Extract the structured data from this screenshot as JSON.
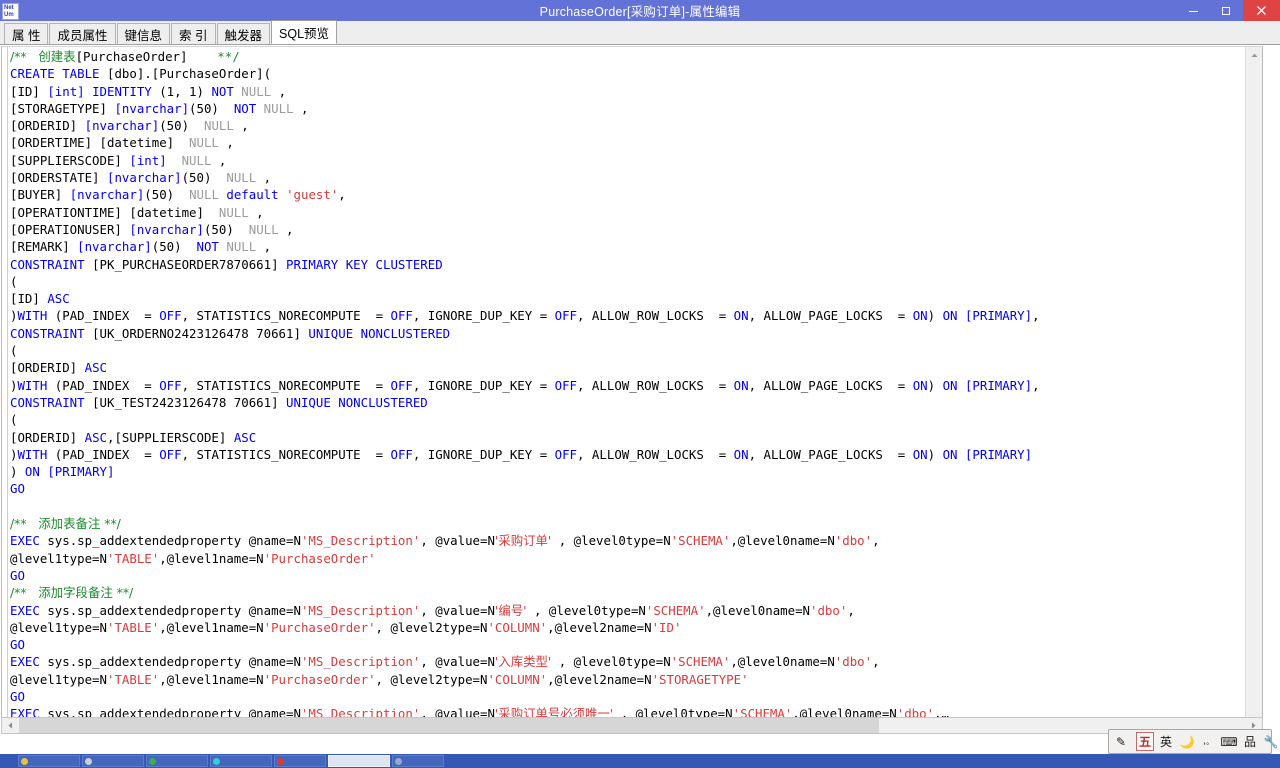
{
  "window": {
    "title": "PurchaseOrder[采购订单]-属性编辑",
    "logo_line1": "Net",
    "logo_line2": "Um",
    "controls": {
      "minimize": "minimize-button",
      "maximize": "restore-button",
      "close": "close-button"
    },
    "accent_titlebar": "#6272d6",
    "accent_close": "#e04344"
  },
  "tabs": [
    {
      "label": "属 性",
      "active": false
    },
    {
      "label": "成员属性",
      "active": false
    },
    {
      "label": "键信息",
      "active": false
    },
    {
      "label": "索 引",
      "active": false
    },
    {
      "label": "触发器",
      "active": false
    },
    {
      "label": "SQL预览",
      "active": true
    }
  ],
  "colors": {
    "keyword": "#0000ee",
    "comment": "#1c8b2c",
    "string": "#d83b3b",
    "null": "#9c9c9c",
    "text": "#000000"
  },
  "editor": {
    "lines": [
      [
        {
          "t": "/**   创建表",
          "c": "cm"
        },
        {
          "t": "[PurchaseOrder]",
          "c": ""
        },
        {
          "t": "    **/",
          "c": "cm"
        }
      ],
      [
        {
          "t": "CREATE TABLE ",
          "c": "kw"
        },
        {
          "t": "[dbo].[PurchaseOrder](",
          "c": ""
        }
      ],
      [
        {
          "t": "[ID] ",
          "c": ""
        },
        {
          "t": "[int] ",
          "c": "kw"
        },
        {
          "t": "IDENTITY ",
          "c": "kw"
        },
        {
          "t": "(1, 1) ",
          "c": ""
        },
        {
          "t": "NOT ",
          "c": "kw"
        },
        {
          "t": "NULL",
          "c": "nul"
        },
        {
          "t": " ,",
          "c": ""
        }
      ],
      [
        {
          "t": "[STORAGETYPE] ",
          "c": ""
        },
        {
          "t": "[nvarchar]",
          "c": "kw"
        },
        {
          "t": "(50)  ",
          "c": ""
        },
        {
          "t": "NOT ",
          "c": "kw"
        },
        {
          "t": "NULL",
          "c": "nul"
        },
        {
          "t": " ,",
          "c": ""
        }
      ],
      [
        {
          "t": "[ORDERID] ",
          "c": ""
        },
        {
          "t": "[nvarchar]",
          "c": "kw"
        },
        {
          "t": "(50)  ",
          "c": ""
        },
        {
          "t": "NULL",
          "c": "nul"
        },
        {
          "t": " ,",
          "c": ""
        }
      ],
      [
        {
          "t": "[ORDERTIME] [datetime]  ",
          "c": ""
        },
        {
          "t": "NULL",
          "c": "nul"
        },
        {
          "t": " ,",
          "c": ""
        }
      ],
      [
        {
          "t": "[SUPPLIERSCODE] ",
          "c": ""
        },
        {
          "t": "[int]",
          "c": "kw"
        },
        {
          "t": "  ",
          "c": ""
        },
        {
          "t": "NULL",
          "c": "nul"
        },
        {
          "t": " ,",
          "c": ""
        }
      ],
      [
        {
          "t": "[ORDERSTATE] ",
          "c": ""
        },
        {
          "t": "[nvarchar]",
          "c": "kw"
        },
        {
          "t": "(50)  ",
          "c": ""
        },
        {
          "t": "NULL",
          "c": "nul"
        },
        {
          "t": " ,",
          "c": ""
        }
      ],
      [
        {
          "t": "[BUYER] ",
          "c": ""
        },
        {
          "t": "[nvarchar]",
          "c": "kw"
        },
        {
          "t": "(50)  ",
          "c": ""
        },
        {
          "t": "NULL ",
          "c": "nul"
        },
        {
          "t": "default ",
          "c": "kw"
        },
        {
          "t": "'guest'",
          "c": "str"
        },
        {
          "t": ",",
          "c": ""
        }
      ],
      [
        {
          "t": "[OPERATIONTIME] [datetime]  ",
          "c": ""
        },
        {
          "t": "NULL",
          "c": "nul"
        },
        {
          "t": " ,",
          "c": ""
        }
      ],
      [
        {
          "t": "[OPERATIONUSER] ",
          "c": ""
        },
        {
          "t": "[nvarchar]",
          "c": "kw"
        },
        {
          "t": "(50)  ",
          "c": ""
        },
        {
          "t": "NULL",
          "c": "nul"
        },
        {
          "t": " ,",
          "c": ""
        }
      ],
      [
        {
          "t": "[REMARK] ",
          "c": ""
        },
        {
          "t": "[nvarchar]",
          "c": "kw"
        },
        {
          "t": "(50)  ",
          "c": ""
        },
        {
          "t": "NOT ",
          "c": "kw"
        },
        {
          "t": "NULL",
          "c": "nul"
        },
        {
          "t": " ,",
          "c": ""
        }
      ],
      [
        {
          "t": "CONSTRAINT ",
          "c": "kw"
        },
        {
          "t": "[PK_PURCHASEORDER7870661] ",
          "c": ""
        },
        {
          "t": "PRIMARY KEY CLUSTERED",
          "c": "kw"
        }
      ],
      [
        {
          "t": "(",
          "c": ""
        }
      ],
      [
        {
          "t": "[ID] ",
          "c": ""
        },
        {
          "t": "ASC",
          "c": "kw"
        }
      ],
      [
        {
          "t": ")",
          "c": ""
        },
        {
          "t": "WITH ",
          "c": "kw"
        },
        {
          "t": "(PAD_INDEX  = ",
          "c": ""
        },
        {
          "t": "OFF",
          "c": "kw"
        },
        {
          "t": ", STATISTICS_NORECOMPUTE  = ",
          "c": ""
        },
        {
          "t": "OFF",
          "c": "kw"
        },
        {
          "t": ", IGNORE_DUP_KEY = ",
          "c": ""
        },
        {
          "t": "OFF",
          "c": "kw"
        },
        {
          "t": ", ALLOW_ROW_LOCKS  = ",
          "c": ""
        },
        {
          "t": "ON",
          "c": "kw"
        },
        {
          "t": ", ALLOW_PAGE_LOCKS  = ",
          "c": ""
        },
        {
          "t": "ON",
          "c": "kw"
        },
        {
          "t": ") ",
          "c": ""
        },
        {
          "t": "ON ",
          "c": "kw"
        },
        {
          "t": "[PRIMARY]",
          "c": "kw"
        },
        {
          "t": ",",
          "c": ""
        }
      ],
      [
        {
          "t": "CONSTRAINT ",
          "c": "kw"
        },
        {
          "t": "[UK_ORDERNO2423126478 70661] ",
          "c": ""
        },
        {
          "t": "UNIQUE NONCLUSTERED",
          "c": "kw"
        }
      ],
      [
        {
          "t": "(",
          "c": ""
        }
      ],
      [
        {
          "t": "[ORDERID] ",
          "c": ""
        },
        {
          "t": "ASC",
          "c": "kw"
        }
      ],
      [
        {
          "t": ")",
          "c": ""
        },
        {
          "t": "WITH ",
          "c": "kw"
        },
        {
          "t": "(PAD_INDEX  = ",
          "c": ""
        },
        {
          "t": "OFF",
          "c": "kw"
        },
        {
          "t": ", STATISTICS_NORECOMPUTE  = ",
          "c": ""
        },
        {
          "t": "OFF",
          "c": "kw"
        },
        {
          "t": ", IGNORE_DUP_KEY = ",
          "c": ""
        },
        {
          "t": "OFF",
          "c": "kw"
        },
        {
          "t": ", ALLOW_ROW_LOCKS  = ",
          "c": ""
        },
        {
          "t": "ON",
          "c": "kw"
        },
        {
          "t": ", ALLOW_PAGE_LOCKS  = ",
          "c": ""
        },
        {
          "t": "ON",
          "c": "kw"
        },
        {
          "t": ") ",
          "c": ""
        },
        {
          "t": "ON ",
          "c": "kw"
        },
        {
          "t": "[PRIMARY]",
          "c": "kw"
        },
        {
          "t": ",",
          "c": ""
        }
      ],
      [
        {
          "t": "CONSTRAINT ",
          "c": "kw"
        },
        {
          "t": "[UK_TEST2423126478 70661] ",
          "c": ""
        },
        {
          "t": "UNIQUE NONCLUSTERED",
          "c": "kw"
        }
      ],
      [
        {
          "t": "(",
          "c": ""
        }
      ],
      [
        {
          "t": "[ORDERID] ",
          "c": ""
        },
        {
          "t": "ASC",
          "c": "kw"
        },
        {
          "t": ",[SUPPLIERSCODE] ",
          "c": ""
        },
        {
          "t": "ASC",
          "c": "kw"
        }
      ],
      [
        {
          "t": ")",
          "c": ""
        },
        {
          "t": "WITH ",
          "c": "kw"
        },
        {
          "t": "(PAD_INDEX  = ",
          "c": ""
        },
        {
          "t": "OFF",
          "c": "kw"
        },
        {
          "t": ", STATISTICS_NORECOMPUTE  = ",
          "c": ""
        },
        {
          "t": "OFF",
          "c": "kw"
        },
        {
          "t": ", IGNORE_DUP_KEY = ",
          "c": ""
        },
        {
          "t": "OFF",
          "c": "kw"
        },
        {
          "t": ", ALLOW_ROW_LOCKS  = ",
          "c": ""
        },
        {
          "t": "ON",
          "c": "kw"
        },
        {
          "t": ", ALLOW_PAGE_LOCKS  = ",
          "c": ""
        },
        {
          "t": "ON",
          "c": "kw"
        },
        {
          "t": ") ",
          "c": ""
        },
        {
          "t": "ON ",
          "c": "kw"
        },
        {
          "t": "[PRIMARY]",
          "c": "kw"
        }
      ],
      [
        {
          "t": ") ",
          "c": ""
        },
        {
          "t": "ON ",
          "c": "kw"
        },
        {
          "t": "[PRIMARY]",
          "c": "kw"
        }
      ],
      [
        {
          "t": "GO",
          "c": "kw"
        }
      ],
      [
        {
          "t": "",
          "c": ""
        }
      ],
      [
        {
          "t": "/**   添加表备注 **/",
          "c": "cm"
        }
      ],
      [
        {
          "t": "EXEC ",
          "c": "kw"
        },
        {
          "t": "sys.sp_addextendedproperty @name=N",
          "c": ""
        },
        {
          "t": "'MS_Description'",
          "c": "str"
        },
        {
          "t": ", @value=N",
          "c": ""
        },
        {
          "t": "'采购订单'",
          "c": "str"
        },
        {
          "t": " , @level0type=N",
          "c": ""
        },
        {
          "t": "'SCHEMA'",
          "c": "str"
        },
        {
          "t": ",@level0name=N",
          "c": ""
        },
        {
          "t": "'dbo'",
          "c": "str"
        },
        {
          "t": ",",
          "c": ""
        }
      ],
      [
        {
          "t": "@level1type=N",
          "c": ""
        },
        {
          "t": "'TABLE'",
          "c": "str"
        },
        {
          "t": ",@level1name=N",
          "c": ""
        },
        {
          "t": "'PurchaseOrder'",
          "c": "str"
        }
      ],
      [
        {
          "t": "GO",
          "c": "kw"
        }
      ],
      [
        {
          "t": "/**   添加字段备注 **/",
          "c": "cm"
        }
      ],
      [
        {
          "t": "EXEC ",
          "c": "kw"
        },
        {
          "t": "sys.sp_addextendedproperty @name=N",
          "c": ""
        },
        {
          "t": "'MS_Description'",
          "c": "str"
        },
        {
          "t": ", @value=N",
          "c": ""
        },
        {
          "t": "'编号'",
          "c": "str"
        },
        {
          "t": " , @level0type=N",
          "c": ""
        },
        {
          "t": "'SCHEMA'",
          "c": "str"
        },
        {
          "t": ",@level0name=N",
          "c": ""
        },
        {
          "t": "'dbo'",
          "c": "str"
        },
        {
          "t": ",",
          "c": ""
        }
      ],
      [
        {
          "t": "@level1type=N",
          "c": ""
        },
        {
          "t": "'TABLE'",
          "c": "str"
        },
        {
          "t": ",@level1name=N",
          "c": ""
        },
        {
          "t": "'PurchaseOrder'",
          "c": "str"
        },
        {
          "t": ", @level2type=N",
          "c": ""
        },
        {
          "t": "'COLUMN'",
          "c": "str"
        },
        {
          "t": ",@level2name=N",
          "c": ""
        },
        {
          "t": "'ID'",
          "c": "str"
        }
      ],
      [
        {
          "t": "GO",
          "c": "kw"
        }
      ],
      [
        {
          "t": "EXEC ",
          "c": "kw"
        },
        {
          "t": "sys.sp_addextendedproperty @name=N",
          "c": ""
        },
        {
          "t": "'MS_Description'",
          "c": "str"
        },
        {
          "t": ", @value=N",
          "c": ""
        },
        {
          "t": "'入库类型'",
          "c": "str"
        },
        {
          "t": " , @level0type=N",
          "c": ""
        },
        {
          "t": "'SCHEMA'",
          "c": "str"
        },
        {
          "t": ",@level0name=N",
          "c": ""
        },
        {
          "t": "'dbo'",
          "c": "str"
        },
        {
          "t": ",",
          "c": ""
        }
      ],
      [
        {
          "t": "@level1type=N",
          "c": ""
        },
        {
          "t": "'TABLE'",
          "c": "str"
        },
        {
          "t": ",@level1name=N",
          "c": ""
        },
        {
          "t": "'PurchaseOrder'",
          "c": "str"
        },
        {
          "t": ", @level2type=N",
          "c": ""
        },
        {
          "t": "'COLUMN'",
          "c": "str"
        },
        {
          "t": ",@level2name=N",
          "c": ""
        },
        {
          "t": "'STORAGETYPE'",
          "c": "str"
        }
      ],
      [
        {
          "t": "GO",
          "c": "kw"
        }
      ],
      [
        {
          "t": "EXEC ",
          "c": "kw"
        },
        {
          "t": "sys.sp_addextendedproperty @name=N",
          "c": ""
        },
        {
          "t": "'MS_Description'",
          "c": "str"
        },
        {
          "t": ", @value=N",
          "c": ""
        },
        {
          "t": "'采购订单号必须唯一'",
          "c": "str"
        },
        {
          "t": " , @level0type=N",
          "c": ""
        },
        {
          "t": "'SCHEMA'",
          "c": "str"
        },
        {
          "t": ",@level0name=N",
          "c": ""
        },
        {
          "t": "'dbo'",
          "c": "str"
        },
        {
          "t": ",…",
          "c": ""
        }
      ]
    ]
  },
  "scrollbars": {
    "vertical_up": "scroll-up-arrow",
    "vertical_down": "scroll-down-arrow",
    "horizontal_left": "scroll-left-arrow",
    "horizontal_right": "scroll-right-arrow"
  },
  "ime": {
    "items": [
      {
        "name": "ime-status-icon",
        "glyph": "✎",
        "boxed": false
      },
      {
        "name": "ime-mode-chinese",
        "glyph": "五",
        "boxed": true
      },
      {
        "name": "ime-mode-english",
        "glyph": "英",
        "boxed": false
      },
      {
        "name": "ime-halfwidth-icon",
        "glyph": "🌙",
        "boxed": false
      },
      {
        "name": "ime-punctuation-icon",
        "glyph": "，。",
        "boxed": false
      },
      {
        "name": "ime-soft-keyboard-icon",
        "glyph": "⌨",
        "boxed": false
      },
      {
        "name": "ime-toolbox-icon",
        "glyph": "品",
        "boxed": false
      },
      {
        "name": "ime-settings-icon",
        "glyph": "🔧",
        "boxed": false
      }
    ]
  },
  "taskbar": {
    "items": [
      {
        "name": "taskbar-item-1",
        "color": "#e8c13a",
        "style": "wide"
      },
      {
        "name": "taskbar-item-2",
        "color": "#c9cdd6",
        "style": "wide"
      },
      {
        "name": "taskbar-item-3",
        "color": "#3fae4a",
        "style": "wide"
      },
      {
        "name": "taskbar-item-4",
        "color": "#2fd0d7",
        "style": "wide"
      },
      {
        "name": "taskbar-item-5",
        "color": "#e03a2f",
        "style": "mid"
      },
      {
        "name": "taskbar-item-6",
        "color": "#dfe4f3",
        "style": "light"
      },
      {
        "name": "taskbar-item-7",
        "color": "#98a8c8",
        "style": "mid"
      }
    ]
  }
}
